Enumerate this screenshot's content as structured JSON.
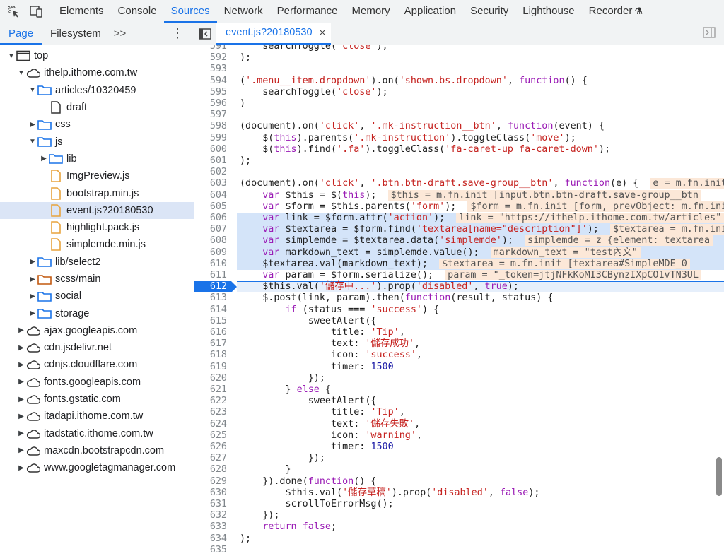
{
  "toolbar": {
    "inspect_icon": "element-picker-icon",
    "device_icon": "device-toggle-icon",
    "tabs": [
      "Elements",
      "Console",
      "Sources",
      "Network",
      "Performance",
      "Memory",
      "Application",
      "Security",
      "Lighthouse",
      "Recorder"
    ],
    "active_tab": "Sources"
  },
  "navigator": {
    "tabs": [
      "Page",
      "Filesystem"
    ],
    "more": ">>",
    "kebab": "⋮",
    "tree": [
      {
        "label": "top",
        "depth": 0,
        "icon": "frame",
        "expanded": true
      },
      {
        "label": "ithelp.ithome.com.tw",
        "depth": 1,
        "icon": "cloud",
        "expanded": true
      },
      {
        "label": "articles/10320459",
        "depth": 2,
        "icon": "folder",
        "expanded": true
      },
      {
        "label": "draft",
        "depth": 3,
        "icon": "doc"
      },
      {
        "label": "css",
        "depth": 2,
        "icon": "folder",
        "expanded": false
      },
      {
        "label": "js",
        "depth": 2,
        "icon": "folder",
        "expanded": true
      },
      {
        "label": "lib",
        "depth": 3,
        "icon": "folder",
        "expanded": false
      },
      {
        "label": "ImgPreview.js",
        "depth": 3,
        "icon": "jsfile"
      },
      {
        "label": "bootstrap.min.js",
        "depth": 3,
        "icon": "jsfile"
      },
      {
        "label": "event.js?20180530",
        "depth": 3,
        "icon": "jsfile",
        "selected": true
      },
      {
        "label": "highlight.pack.js",
        "depth": 3,
        "icon": "jsfile"
      },
      {
        "label": "simplemde.min.js",
        "depth": 3,
        "icon": "jsfile"
      },
      {
        "label": "lib/select2",
        "depth": 2,
        "icon": "folder",
        "expanded": false
      },
      {
        "label": "scss/main",
        "depth": 2,
        "icon": "folder-orange",
        "expanded": false
      },
      {
        "label": "social",
        "depth": 2,
        "icon": "folder",
        "expanded": false
      },
      {
        "label": "storage",
        "depth": 2,
        "icon": "folder",
        "expanded": false
      },
      {
        "label": "ajax.googleapis.com",
        "depth": 1,
        "icon": "cloud",
        "expanded": false
      },
      {
        "label": "cdn.jsdelivr.net",
        "depth": 1,
        "icon": "cloud",
        "expanded": false
      },
      {
        "label": "cdnjs.cloudflare.com",
        "depth": 1,
        "icon": "cloud",
        "expanded": false
      },
      {
        "label": "fonts.googleapis.com",
        "depth": 1,
        "icon": "cloud",
        "expanded": false
      },
      {
        "label": "fonts.gstatic.com",
        "depth": 1,
        "icon": "cloud",
        "expanded": false
      },
      {
        "label": "itadapi.ithome.com.tw",
        "depth": 1,
        "icon": "cloud",
        "expanded": false
      },
      {
        "label": "itadstatic.ithome.com.tw",
        "depth": 1,
        "icon": "cloud",
        "expanded": false
      },
      {
        "label": "maxcdn.bootstrapcdn.com",
        "depth": 1,
        "icon": "cloud",
        "expanded": false
      },
      {
        "label": "www.googletagmanager.com",
        "depth": 1,
        "icon": "cloud",
        "expanded": false
      }
    ]
  },
  "editor": {
    "tab_label": "event.js?20180530",
    "close_glyph": "×",
    "breakpoint_line": "612",
    "lines": [
      {
        "n": "591",
        "tokens": [
          [
            "",
            "    searchToggle("
          ],
          [
            "s",
            "'close'"
          ],
          [
            "",
            ");"
          ]
        ]
      },
      {
        "n": "592",
        "tokens": [
          [
            "",
            ");"
          ]
        ]
      },
      {
        "n": "593",
        "tokens": []
      },
      {
        "n": "594",
        "tokens": [
          [
            "",
            "("
          ],
          [
            "s",
            "'.menu__item.dropdown'"
          ],
          [
            "",
            ").on("
          ],
          [
            "s",
            "'shown.bs.dropdown'"
          ],
          [
            "",
            ", "
          ],
          [
            "k",
            "function"
          ],
          [
            "",
            "() {"
          ]
        ]
      },
      {
        "n": "595",
        "tokens": [
          [
            "",
            "    searchToggle("
          ],
          [
            "s",
            "'close'"
          ],
          [
            "",
            ");"
          ]
        ]
      },
      {
        "n": "596",
        "tokens": [
          [
            "",
            ")"
          ]
        ]
      },
      {
        "n": "597",
        "tokens": []
      },
      {
        "n": "598",
        "tokens": [
          [
            "",
            "(document).on("
          ],
          [
            "s",
            "'click'"
          ],
          [
            "",
            ", "
          ],
          [
            "s",
            "'.mk-instruction__btn'"
          ],
          [
            "",
            ", "
          ],
          [
            "k",
            "function"
          ],
          [
            "",
            "(event) {"
          ]
        ]
      },
      {
        "n": "599",
        "tokens": [
          [
            "",
            "    $("
          ],
          [
            "k",
            "this"
          ],
          [
            "",
            ").parents("
          ],
          [
            "s",
            "'.mk-instruction'"
          ],
          [
            "",
            ").toggleClass("
          ],
          [
            "s",
            "'move'"
          ],
          [
            "",
            ");"
          ]
        ]
      },
      {
        "n": "600",
        "tokens": [
          [
            "",
            "    $("
          ],
          [
            "k",
            "this"
          ],
          [
            "",
            ").find("
          ],
          [
            "s",
            "'.fa'"
          ],
          [
            "",
            ").toggleClass("
          ],
          [
            "s",
            "'fa-caret-up fa-caret-down'"
          ],
          [
            "",
            ");"
          ]
        ]
      },
      {
        "n": "601",
        "tokens": [
          [
            "",
            ");"
          ]
        ]
      },
      {
        "n": "602",
        "tokens": []
      },
      {
        "n": "603",
        "tokens": [
          [
            "",
            "(document).on("
          ],
          [
            "s",
            "'click'"
          ],
          [
            "",
            ", "
          ],
          [
            "s",
            "'.btn.btn-draft.save-group__btn'"
          ],
          [
            "",
            ", "
          ],
          [
            "k",
            "function"
          ],
          [
            "",
            "(e) { "
          ],
          [
            "i",
            "e = m.fn.init"
          ]
        ]
      },
      {
        "n": "604",
        "tokens": [
          [
            "",
            "    "
          ],
          [
            "k",
            "var"
          ],
          [
            "",
            " $this = $("
          ],
          [
            "k",
            "this"
          ],
          [
            "",
            "); "
          ],
          [
            "i",
            "$this = m.fn.init [input.btn.btn-draft.save-group__btn"
          ]
        ]
      },
      {
        "n": "605",
        "tokens": [
          [
            "",
            "    "
          ],
          [
            "k",
            "var"
          ],
          [
            "",
            " $form = $this.parents("
          ],
          [
            "s",
            "'form'"
          ],
          [
            "",
            "); "
          ],
          [
            "i",
            "$form = m.fn.init [form, prevObject: m.fn.init"
          ]
        ]
      },
      {
        "n": "606",
        "tokens": [
          [
            "",
            "    "
          ],
          [
            "k",
            "var"
          ],
          [
            "",
            " link = $form.attr("
          ],
          [
            "s",
            "'action'"
          ],
          [
            "",
            "); "
          ],
          [
            "i",
            "link = \"https://ithelp.ithome.com.tw/articles\""
          ]
        ],
        "hl": true
      },
      {
        "n": "607",
        "tokens": [
          [
            "",
            "    "
          ],
          [
            "k",
            "var"
          ],
          [
            "",
            " $textarea = $form.find("
          ],
          [
            "s",
            "'textarea[name=\"description\"]'"
          ],
          [
            "",
            "); "
          ],
          [
            "i",
            "$textarea = m.fn.init"
          ]
        ],
        "hl": true
      },
      {
        "n": "608",
        "tokens": [
          [
            "",
            "    "
          ],
          [
            "k",
            "var"
          ],
          [
            "",
            " simplemde = $textarea.data("
          ],
          [
            "s",
            "'simplemde'"
          ],
          [
            "",
            "); "
          ],
          [
            "i",
            "simplemde = z {element: textarea"
          ]
        ],
        "hl": true
      },
      {
        "n": "609",
        "tokens": [
          [
            "",
            "    "
          ],
          [
            "k",
            "var"
          ],
          [
            "",
            " markdown_text = simplemde.value(); "
          ],
          [
            "i",
            "markdown_text = \"test內文\""
          ]
        ],
        "hl": true
      },
      {
        "n": "610",
        "tokens": [
          [
            "",
            "    $textarea.val(markdown_text); "
          ],
          [
            "i",
            "$textarea = m.fn.init [textarea#SimpleMDE_0"
          ]
        ],
        "hl": true
      },
      {
        "n": "611",
        "tokens": [
          [
            "",
            "    "
          ],
          [
            "k",
            "var"
          ],
          [
            "",
            " param = $form.serialize(); "
          ],
          [
            "i",
            "param = \"_token=jtjNFkKoMI3CBynzIXpCO1vTN3UL"
          ]
        ]
      },
      {
        "n": "612",
        "tokens": [
          [
            "",
            "    $this.val("
          ],
          [
            "s",
            "'儲存中...'"
          ],
          [
            "",
            ").prop("
          ],
          [
            "s",
            "'disabled'"
          ],
          [
            "",
            ", "
          ],
          [
            "k",
            "true"
          ],
          [
            "",
            ");"
          ]
        ],
        "exec": true
      },
      {
        "n": "613",
        "tokens": [
          [
            "",
            "    $.post(link, param).then("
          ],
          [
            "k",
            "function"
          ],
          [
            "",
            "(result, status) {"
          ]
        ]
      },
      {
        "n": "614",
        "tokens": [
          [
            "",
            "        "
          ],
          [
            "k",
            "if"
          ],
          [
            "",
            " (status === "
          ],
          [
            "s",
            "'success'"
          ],
          [
            "",
            ") {"
          ]
        ]
      },
      {
        "n": "615",
        "tokens": [
          [
            "",
            "            sweetAlert({"
          ]
        ]
      },
      {
        "n": "616",
        "tokens": [
          [
            "",
            "                title: "
          ],
          [
            "s",
            "'Tip'"
          ],
          [
            "",
            ","
          ]
        ]
      },
      {
        "n": "617",
        "tokens": [
          [
            "",
            "                text: "
          ],
          [
            "s",
            "'儲存成功'"
          ],
          [
            "",
            ","
          ]
        ]
      },
      {
        "n": "618",
        "tokens": [
          [
            "",
            "                icon: "
          ],
          [
            "s",
            "'success'"
          ],
          [
            "",
            ","
          ]
        ]
      },
      {
        "n": "619",
        "tokens": [
          [
            "",
            "                timer: "
          ],
          [
            "n",
            "1500"
          ]
        ]
      },
      {
        "n": "620",
        "tokens": [
          [
            "",
            "            });"
          ]
        ]
      },
      {
        "n": "621",
        "tokens": [
          [
            "",
            "        } "
          ],
          [
            "k",
            "else"
          ],
          [
            "",
            " {"
          ]
        ]
      },
      {
        "n": "622",
        "tokens": [
          [
            "",
            "            sweetAlert({"
          ]
        ]
      },
      {
        "n": "623",
        "tokens": [
          [
            "",
            "                title: "
          ],
          [
            "s",
            "'Tip'"
          ],
          [
            "",
            ","
          ]
        ]
      },
      {
        "n": "624",
        "tokens": [
          [
            "",
            "                text: "
          ],
          [
            "s",
            "'儲存失敗'"
          ],
          [
            "",
            ","
          ]
        ]
      },
      {
        "n": "625",
        "tokens": [
          [
            "",
            "                icon: "
          ],
          [
            "s",
            "'warning'"
          ],
          [
            "",
            ","
          ]
        ]
      },
      {
        "n": "626",
        "tokens": [
          [
            "",
            "                timer: "
          ],
          [
            "n",
            "1500"
          ]
        ]
      },
      {
        "n": "627",
        "tokens": [
          [
            "",
            "            });"
          ]
        ]
      },
      {
        "n": "628",
        "tokens": [
          [
            "",
            "        }"
          ]
        ]
      },
      {
        "n": "629",
        "tokens": [
          [
            "",
            "    }).done("
          ],
          [
            "k",
            "function"
          ],
          [
            "",
            "() {"
          ]
        ]
      },
      {
        "n": "630",
        "tokens": [
          [
            "",
            "        $this.val("
          ],
          [
            "s",
            "'儲存草稿'"
          ],
          [
            "",
            ").prop("
          ],
          [
            "s",
            "'disabled'"
          ],
          [
            "",
            ", "
          ],
          [
            "k",
            "false"
          ],
          [
            "",
            ");"
          ]
        ]
      },
      {
        "n": "631",
        "tokens": [
          [
            "",
            "        scrollToErrorMsg();"
          ]
        ]
      },
      {
        "n": "632",
        "tokens": [
          [
            "",
            "    });"
          ]
        ]
      },
      {
        "n": "633",
        "tokens": [
          [
            "",
            "    "
          ],
          [
            "k",
            "return"
          ],
          [
            "",
            " "
          ],
          [
            "k",
            "false"
          ],
          [
            "",
            ";"
          ]
        ]
      },
      {
        "n": "634",
        "tokens": [
          [
            "",
            ");"
          ]
        ]
      },
      {
        "n": "635",
        "tokens": []
      }
    ]
  }
}
